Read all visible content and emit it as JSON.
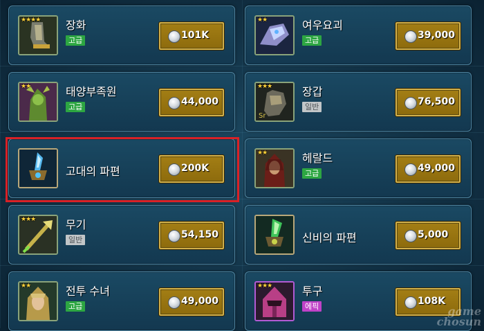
{
  "items": [
    {
      "name": "장화",
      "grade": "고급",
      "grade_color": "#2da642",
      "stars": "★★★★",
      "price": "101K",
      "icon": "boots-icon"
    },
    {
      "name": "여우요괴",
      "grade": "고급",
      "grade_color": "#2da642",
      "stars": "★★",
      "price": "39,000",
      "icon": "fox-spirit-icon"
    },
    {
      "name": "태양부족원",
      "grade": "고급",
      "grade_color": "#2da642",
      "stars": "★★",
      "price": "44,000",
      "icon": "sun-tribe-icon"
    },
    {
      "name": "장갑",
      "grade": "일반",
      "grade_color": "#c2c6c8",
      "stars": "★★★",
      "price": "76,500",
      "icon": "gloves-icon"
    },
    {
      "name": "고대의 파편",
      "grade": "",
      "stars": "",
      "price": "200K",
      "icon": "ancient-shard-icon"
    },
    {
      "name": "헤랄드",
      "grade": "고급",
      "grade_color": "#2da642",
      "stars": "★★",
      "price": "49,000",
      "icon": "herald-icon"
    },
    {
      "name": "무기",
      "grade": "일반",
      "grade_color": "#c2c6c8",
      "stars": "★★★",
      "price": "54,150",
      "icon": "weapon-icon"
    },
    {
      "name": "신비의 파편",
      "grade": "",
      "stars": "",
      "price": "5,000",
      "icon": "mystery-shard-icon"
    },
    {
      "name": "전투 수녀",
      "grade": "고급",
      "grade_color": "#2da642",
      "stars": "★★",
      "price": "49,000",
      "icon": "battle-nun-icon"
    },
    {
      "name": "투구",
      "grade": "에픽",
      "grade_color": "#c042c8",
      "stars": "★★★",
      "price": "108K",
      "icon": "helmet-icon"
    }
  ],
  "highlight_color": "#d92126",
  "watermark": {
    "line1": "game",
    "line2": "chosun"
  }
}
